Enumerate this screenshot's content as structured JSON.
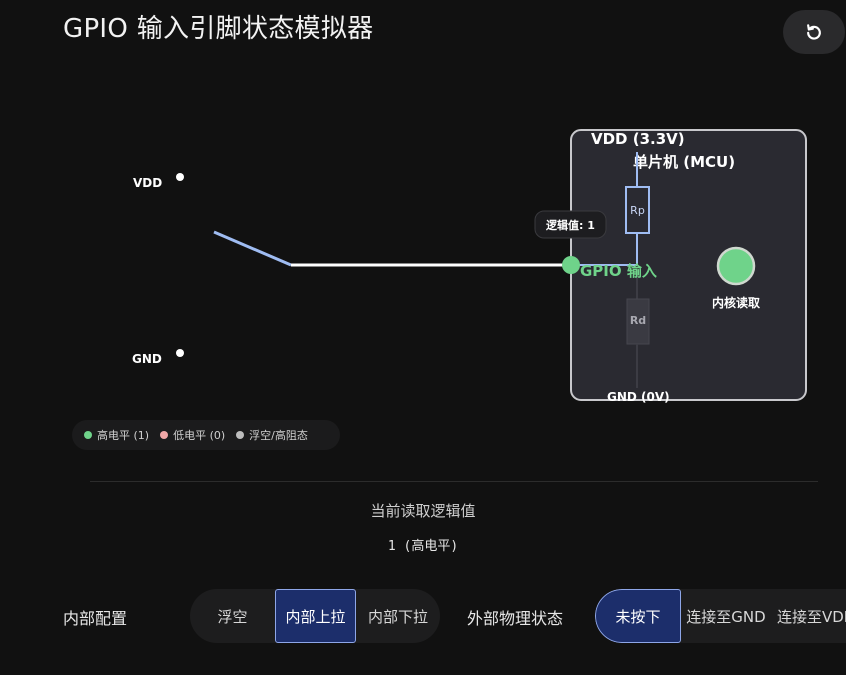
{
  "title": "GPIO 输入引脚状态模拟器",
  "reset_icon": "rotate-ccw-icon",
  "circuit": {
    "vdd_left": "VDD",
    "gnd_left": "GND",
    "mcu_vdd": "VDD (3.3V)",
    "mcu_title": "单片机 (MCU)",
    "rp": "Rp",
    "rd": "Rd",
    "gpio_label": "GPIO 输入",
    "core_label": "内核读取",
    "mcu_gnd": "GND (0V)",
    "logic_tooltip": "逻辑值: 1"
  },
  "legend": [
    {
      "label": "高电平 (1)",
      "color": "#6fd38a"
    },
    {
      "label": "低电平 (0)",
      "color": "#f0a6a6"
    },
    {
      "label": "浮空/高阻态",
      "color": "#bdbdbd"
    }
  ],
  "readout": {
    "label": "当前读取逻辑值",
    "value": "1 (高电平)"
  },
  "internal": {
    "label": "内部配置",
    "options": [
      "浮空",
      "内部上拉",
      "内部下拉"
    ],
    "selected": "内部上拉"
  },
  "external": {
    "label": "外部物理状态",
    "options": [
      "未按下",
      "连接至GND",
      "连接至VDD"
    ],
    "selected": "未按下"
  },
  "colors": {
    "high": "#6fd38a",
    "wire_inactive": "#9fbcf2",
    "accent": "#1c2e6b"
  }
}
